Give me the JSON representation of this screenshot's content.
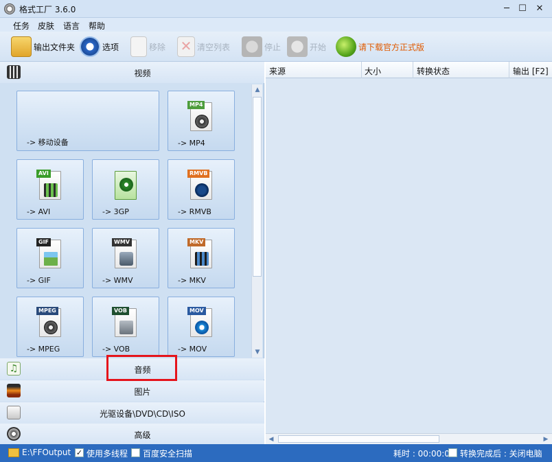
{
  "window": {
    "title": "格式工厂 3.6.0"
  },
  "menu": [
    "任务",
    "皮肤",
    "语言",
    "帮助"
  ],
  "toolbar": {
    "output_folder": "输出文件夹",
    "options": "选项",
    "remove": "移除",
    "clear_list": "清空列表",
    "stop": "停止",
    "start": "开始",
    "download": "请下载官方正式版"
  },
  "categories": {
    "video": "视频",
    "audio": "音频",
    "picture": "图片",
    "rom": "光驱设备\\DVD\\CD\\ISO",
    "advanced": "高级"
  },
  "tiles": [
    {
      "label": "-> 移动设备",
      "badge": ""
    },
    {
      "label": "-> MP4",
      "badge": "MP4"
    },
    {
      "label": "-> AVI",
      "badge": "AVI"
    },
    {
      "label": "-> 3GP",
      "badge": "3GP"
    },
    {
      "label": "-> RMVB",
      "badge": "RMVB"
    },
    {
      "label": "-> GIF",
      "badge": "GIF"
    },
    {
      "label": "-> WMV",
      "badge": "WMV"
    },
    {
      "label": "-> MKV",
      "badge": "MKV"
    },
    {
      "label": "-> MPEG",
      "badge": "MPEG"
    },
    {
      "label": "-> VOB",
      "badge": "VOB"
    },
    {
      "label": "-> MOV",
      "badge": "MOV"
    }
  ],
  "table": {
    "columns": [
      "来源",
      "大小",
      "转换状态",
      "输出 [F2]"
    ]
  },
  "status": {
    "output_path": "E:\\FFOutput",
    "multithread": "使用多线程",
    "baidu_scan": "百度安全扫描",
    "elapsed": "耗时 : 00:00:00",
    "after_done": "转换完成后 : 关闭电脑"
  },
  "colors": {
    "accent": "#2c6bbf",
    "highlight": "#e5131b",
    "download_text": "#e05a00"
  }
}
